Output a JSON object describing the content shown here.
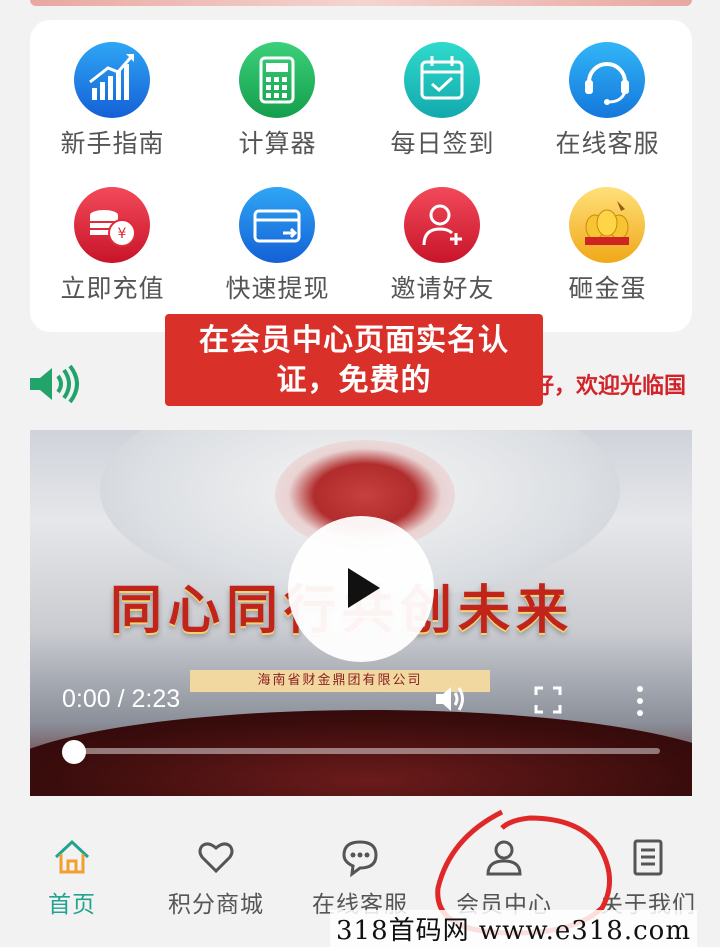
{
  "grid": {
    "items": [
      {
        "label": "新手指南",
        "icon": "growth-chart-icon",
        "color": "#1e7de0"
      },
      {
        "label": "计算器",
        "icon": "calculator-icon",
        "color": "#1fae5c"
      },
      {
        "label": "每日签到",
        "icon": "calendar-check-icon",
        "color": "#17b9b3"
      },
      {
        "label": "在线客服",
        "icon": "headset-icon",
        "color": "#1a8fe0"
      },
      {
        "label": "立即充值",
        "icon": "coins-icon",
        "color": "#e02a3a"
      },
      {
        "label": "快速提现",
        "icon": "card-withdraw-icon",
        "color": "#1e7de0"
      },
      {
        "label": "邀请好友",
        "icon": "add-user-icon",
        "color": "#e02a3a"
      },
      {
        "label": "砸金蛋",
        "icon": "golden-egg-icon",
        "color": "#f2b320"
      }
    ]
  },
  "notice": {
    "tooltip": "在会员中心页面实名认证，免费的",
    "tooltip_line1": "在会员中心页面实名认",
    "tooltip_line2": "证，免费的",
    "marquee": "好，欢迎光临国"
  },
  "video": {
    "slogan": "同心同行共创未来",
    "company": "海南省财金鼎团有限公司",
    "time": "0:00 / 2:23",
    "progress": 0
  },
  "tabbar": {
    "tabs": [
      {
        "label": "首页",
        "icon": "home-icon",
        "active": true
      },
      {
        "label": "积分商城",
        "icon": "heart-icon",
        "active": false
      },
      {
        "label": "在线客服",
        "icon": "chat-bubble-icon",
        "active": false
      },
      {
        "label": "会员中心",
        "icon": "user-icon",
        "active": false
      },
      {
        "label": "关于我们",
        "icon": "document-icon",
        "active": false
      }
    ],
    "active_color": "#22a38f"
  },
  "watermark": "318首码网  www.e318.com"
}
